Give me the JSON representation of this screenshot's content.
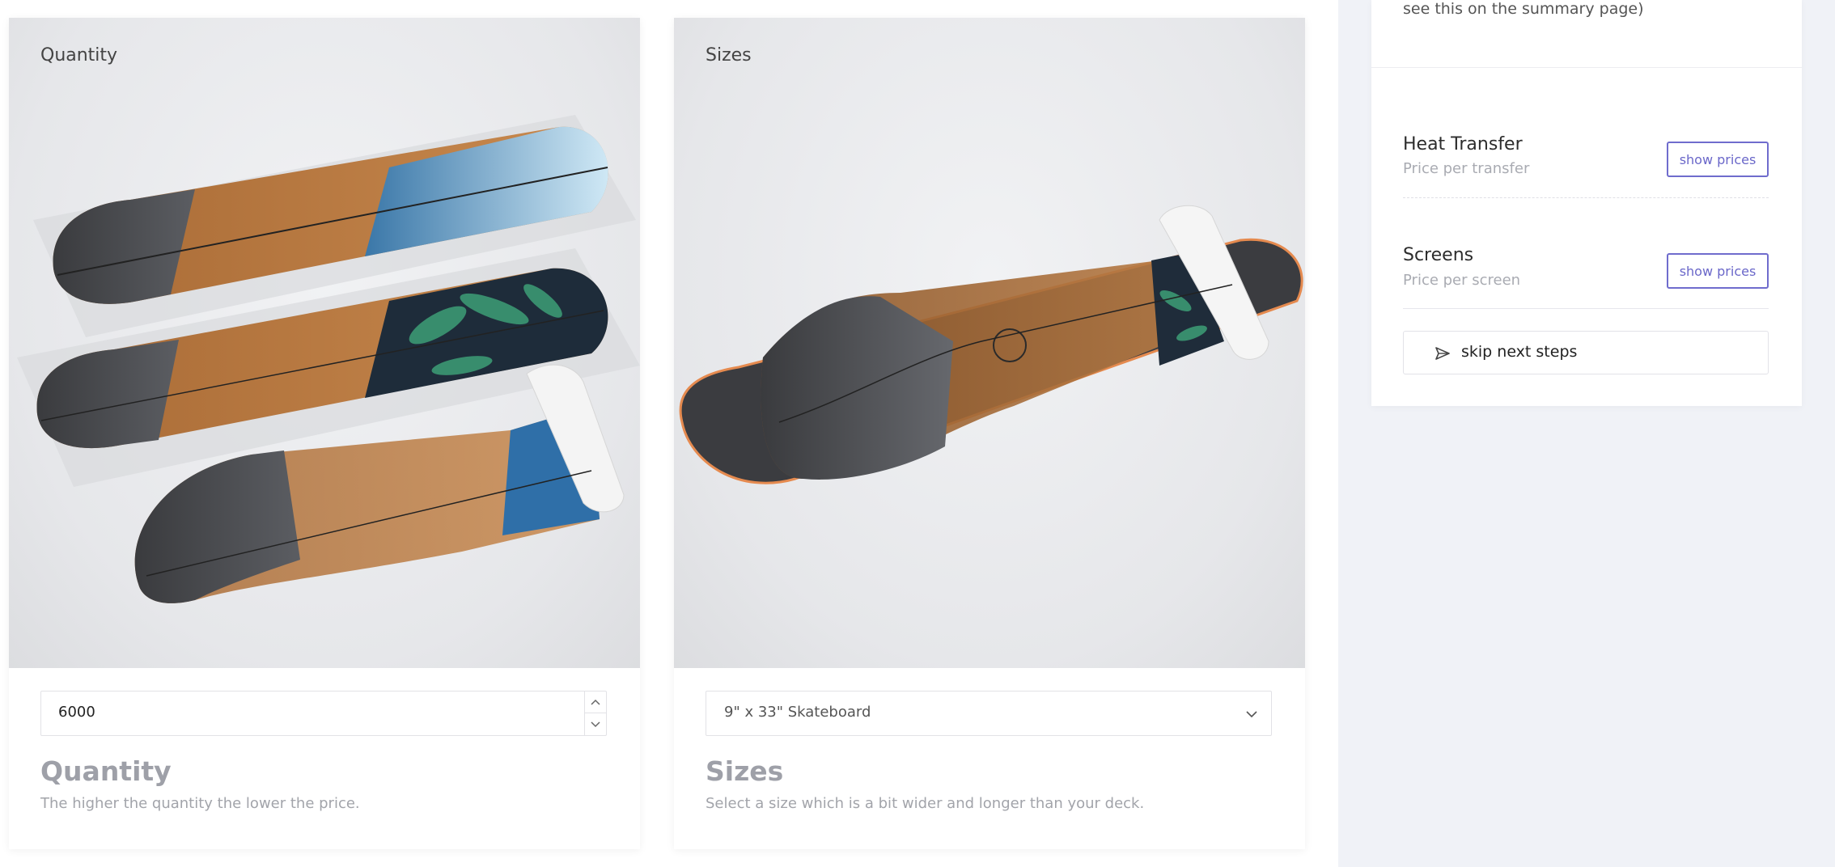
{
  "quantity_card": {
    "caption": "Quantity",
    "input_value": "6000",
    "title": "Quantity",
    "description": "The higher the quantity the lower the price."
  },
  "sizes_card": {
    "caption": "Sizes",
    "selected_size": "9\" x 33\" Skateboard",
    "title": "Sizes",
    "description": "Select a size which is a bit wider and longer than your deck."
  },
  "sidebar": {
    "top_text": "see this on the summary page)",
    "options": [
      {
        "title": "Heat Transfer",
        "subtitle": "Price per transfer",
        "button_label": "show prices"
      },
      {
        "title": "Screens",
        "subtitle": "Price per screen",
        "button_label": "show prices"
      }
    ],
    "skip_label": "skip next steps"
  },
  "colors": {
    "accent": "#6f6ccd",
    "page_bg": "#f0f2f7",
    "muted_text": "#a2a4aa"
  },
  "icons": {
    "spin_up": "chevron-up-icon",
    "spin_down": "chevron-down-icon",
    "select": "chevron-down-icon",
    "skip": "send-icon"
  }
}
